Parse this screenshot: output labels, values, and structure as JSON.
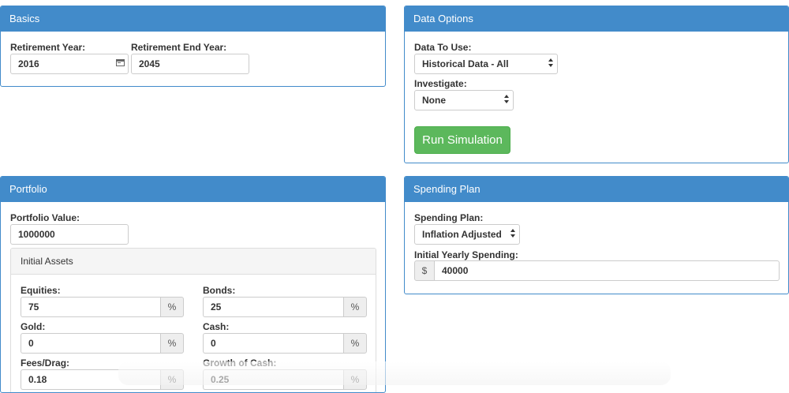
{
  "basics": {
    "title": "Basics",
    "retirement_year_label": "Retirement Year:",
    "retirement_year_value": "2016",
    "retirement_end_year_label": "Retirement End Year:",
    "retirement_end_year_value": "2045"
  },
  "data_options": {
    "title": "Data Options",
    "data_to_use_label": "Data To Use:",
    "data_to_use_value": "Historical Data - All",
    "investigate_label": "Investigate:",
    "investigate_value": "None",
    "run_button_label": "Run Simulation"
  },
  "portfolio": {
    "title": "Portfolio",
    "value_label": "Portfolio Value:",
    "value": "1000000",
    "initial_assets": {
      "title": "Initial Assets",
      "percent_symbol": "%",
      "equities_label": "Equities:",
      "equities_value": "75",
      "bonds_label": "Bonds:",
      "bonds_value": "25",
      "gold_label": "Gold:",
      "gold_value": "0",
      "cash_label": "Cash:",
      "cash_value": "0",
      "fees_label": "Fees/Drag:",
      "fees_value": "0.18",
      "growth_label": "Growth of Cash:",
      "growth_value": "0.25"
    }
  },
  "spending_plan": {
    "title": "Spending Plan",
    "plan_label": "Spending Plan:",
    "plan_value": "Inflation Adjusted",
    "initial_spending_label": "Initial Yearly Spending:",
    "currency_symbol": "$",
    "initial_spending_value": "40000"
  },
  "colors": {
    "panel_primary": "#428bca",
    "success_button": "#5cb85c"
  }
}
